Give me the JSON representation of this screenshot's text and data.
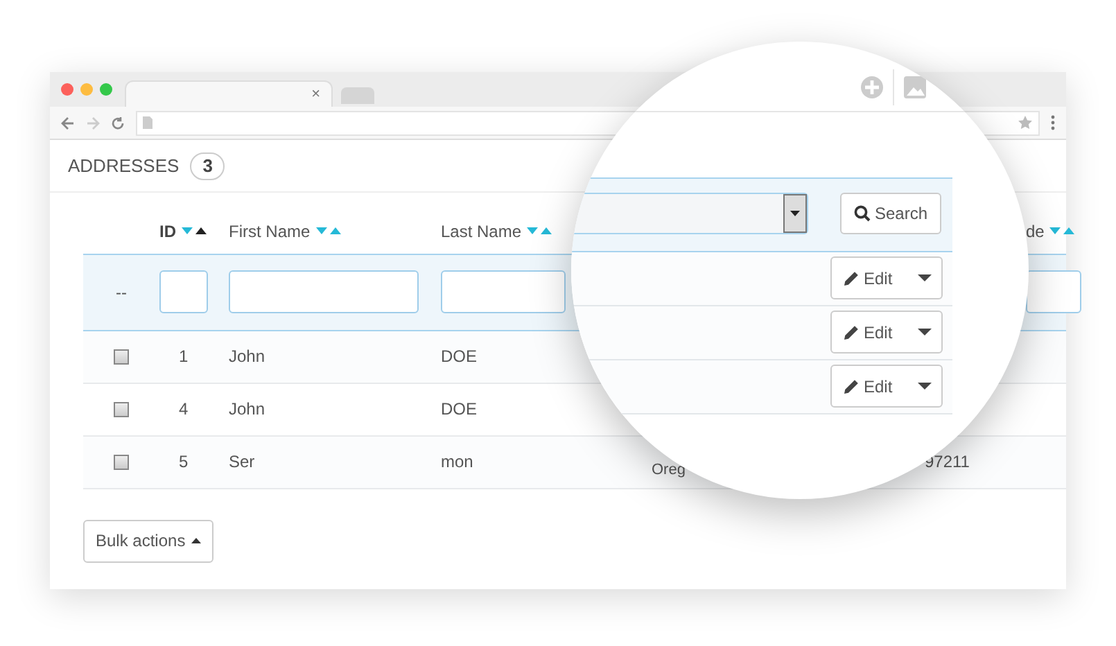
{
  "browser": {
    "tabs": [
      {
        "close": "×",
        "selected": true
      },
      {
        "selected": false
      }
    ]
  },
  "page": {
    "title": "ADDRESSES",
    "count": "3"
  },
  "table": {
    "columns": [
      {
        "label": "ID",
        "sort_up_active": true
      },
      {
        "label": "First Name",
        "sort_up_active": false
      },
      {
        "label": "Last Name",
        "sort_up_active": false
      },
      {
        "label": "de",
        "sort_up_active": false
      }
    ],
    "filter": {
      "reset": "--"
    },
    "rows": [
      {
        "checked": false,
        "id": "1",
        "first_name": "John",
        "last_name": "DOE"
      },
      {
        "checked": false,
        "id": "4",
        "first_name": "John",
        "last_name": "DOE"
      },
      {
        "checked": false,
        "id": "5",
        "first_name": "Ser",
        "last_name": "mon",
        "column_4": "Oreg",
        "column_6": "97211"
      }
    ]
  },
  "bulk_actions": "Bulk actions",
  "magnifier": {
    "search_button": "Search",
    "rows": [
      {
        "edit": "Edit"
      },
      {
        "edit": "Edit"
      },
      {
        "edit": "Edit"
      }
    ]
  }
}
